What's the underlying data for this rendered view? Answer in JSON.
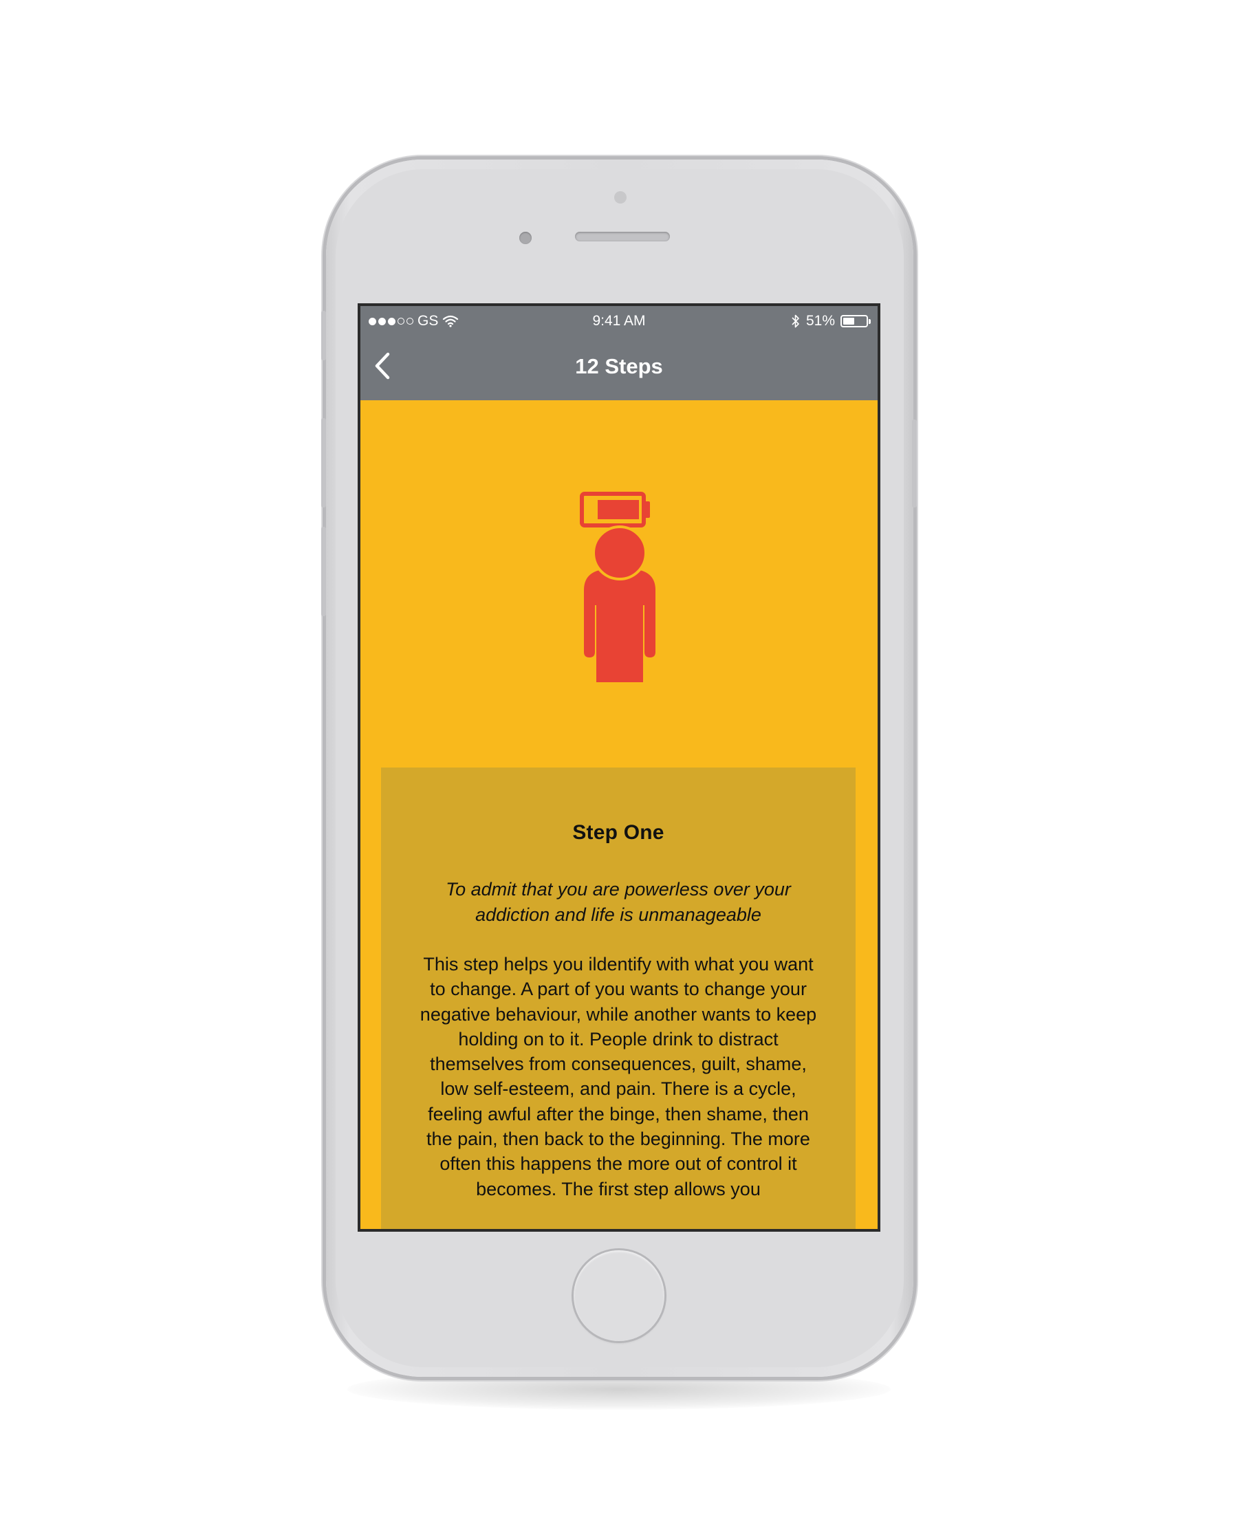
{
  "status_bar": {
    "carrier": "GS",
    "time": "9:41 AM",
    "battery_percent": "51%",
    "battery_level": 0.51,
    "signal_bars_filled": 3,
    "signal_bars_total": 5
  },
  "nav": {
    "title": "12 Steps",
    "back_icon": "chevron-left-icon"
  },
  "hero": {
    "icon": "person-low-battery-icon",
    "colors": {
      "figure": "#e84334",
      "background": "#f9b91c"
    }
  },
  "step": {
    "title": "Step One",
    "subtitle": "To admit that you are powerless over your addiction and life is unmanageable",
    "body": "This step helps you ildentify with what you want to change. A part of you wants to change your negative behaviour, while another wants to keep holding on to it. People drink to distract themselves from consequences, guilt, shame, low self-esteem, and pain. There is a cycle, feeling awful after the binge, then shame, then the pain, then back to the beginning. The more often this happens the more out of control it becomes. The first step allows you"
  },
  "colors": {
    "top_bar": "#73777c",
    "page_background": "#f9b91c",
    "card_background": "#d4a82a",
    "accent": "#e84334"
  }
}
